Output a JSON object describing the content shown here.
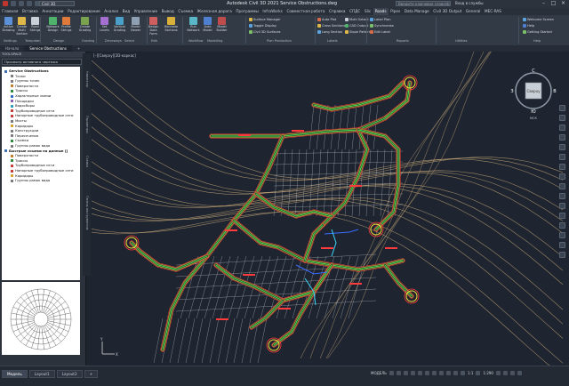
{
  "app_title": "Autodesk Civil 3D 2021    Service Obstructions.dwg",
  "workspace": "Civil 3D",
  "search_placeholder": "Введите ключевое слово/фразу",
  "user": "Вход в службы",
  "ribbon_tabs": [
    "Главная",
    "Вставка",
    "Аннотации",
    "Редактирование",
    "Анализ",
    "Вид",
    "Управление",
    "Вывод",
    "Съемка",
    "Железная дорога",
    "Программы",
    "InfraWorks",
    "Совместная работа",
    "Справка",
    "СПДС",
    "Slic",
    "Roads",
    "Pipes",
    "Data Manage",
    "Civil 3D Output",
    "General",
    "MEC-RAS"
  ],
  "active_ribbon_tab": "Roads",
  "ribbon": {
    "buttons": [
      {
        "label": "Active Drawing",
        "color": "#5b8fd6"
      },
      {
        "label": "Create Multi Section",
        "color": "#e0b84a"
      },
      {
        "label": "Road Strings",
        "color": "#c9d0d8"
      },
      {
        "label": "Network Design",
        "color": "#4fb36b"
      },
      {
        "label": "Profile Strings",
        "color": "#e07a3a"
      },
      {
        "label": "Create Grading",
        "color": "#7aa34f"
      },
      {
        "label": "Set Levels",
        "color": "#a56fd1"
      },
      {
        "label": "Vertical Grading",
        "color": "#4aa0c9"
      },
      {
        "label": "Model Viewer",
        "color": "#8fa0b3"
      },
      {
        "label": "Design Data Form",
        "color": "#cf5f5f"
      },
      {
        "label": "Recreate Sections",
        "color": "#d9b03a"
      },
      {
        "label": "Run Network",
        "color": "#5ab7c8"
      },
      {
        "label": "Auto Model",
        "color": "#4e7fd0"
      },
      {
        "label": "Model Builder",
        "color": "#bf4c4c"
      }
    ],
    "small_tools": [
      {
        "label": "Surface Manager",
        "color": "#e0b84a"
      },
      {
        "label": "Toggle Display",
        "color": "#5aa3e0"
      },
      {
        "label": "Civil 3D Surfaces",
        "color": "#7bbf6a"
      },
      {
        "label": "Auto Plot",
        "color": "#d46a4a"
      },
      {
        "label": "Cross Sections",
        "color": "#e0b84a"
      },
      {
        "label": "Long Section",
        "color": "#5aa3e0"
      },
      {
        "label": "Multi Setout",
        "color": "#c9d0d8"
      },
      {
        "label": "CAD Output",
        "color": "#4fb36b"
      },
      {
        "label": "Slope Pattern",
        "color": "#e0b84a"
      },
      {
        "label": "Label Plan",
        "color": "#5aa3e0"
      },
      {
        "label": "Synchronise",
        "color": "#7bbf6a"
      },
      {
        "label": "Edit Label",
        "color": "#d46a4a"
      },
      {
        "label": "Welcome Screen",
        "color": "#5aa3e0"
      },
      {
        "label": "Help",
        "color": "#4e7fd0"
      },
      {
        "label": "Getting Started",
        "color": "#7bbf6a"
      }
    ],
    "panels": [
      "Settings",
      "Templates",
      "Design",
      "Grading",
      "Driveways",
      "Select",
      "Edit",
      "Workflow",
      "Modelling",
      "Plan Production",
      "Labels",
      "Reports",
      "Utilities",
      "Help"
    ]
  },
  "doc_tabs": [
    "Начало",
    "Service Obstructions"
  ],
  "toolspace": {
    "title": "TOOLSPACE",
    "view": "Просмотр активного чертежа",
    "tree": [
      {
        "label": "Service Obstructions",
        "level": 0,
        "color": "#3a6fb8"
      },
      {
        "label": "Точки",
        "level": 1,
        "color": "#7a7a7a"
      },
      {
        "label": "Группы точек",
        "level": 1,
        "color": "#7a7a7a"
      },
      {
        "label": "Поверхности",
        "level": 1,
        "color": "#c27a2a"
      },
      {
        "label": "Трассы",
        "level": 1,
        "color": "#2a8a3a"
      },
      {
        "label": "Характерные линии",
        "level": 1,
        "color": "#2a6ac2"
      },
      {
        "label": "Площадки",
        "level": 1,
        "color": "#8a5ab2"
      },
      {
        "label": "Водосборы",
        "level": 1,
        "color": "#2a9ab2"
      },
      {
        "label": "Трубопроводные сети",
        "level": 1,
        "color": "#c23a3a"
      },
      {
        "label": "Напорные трубопроводные сети",
        "level": 1,
        "color": "#c23a3a"
      },
      {
        "label": "Мосты",
        "level": 1,
        "color": "#7a7a7a"
      },
      {
        "label": "Коридоры",
        "level": 1,
        "color": "#d2a22a"
      },
      {
        "label": "Конструкции",
        "level": 1,
        "color": "#7a7a7a"
      },
      {
        "label": "Пересечения",
        "level": 1,
        "color": "#7a7a7a"
      },
      {
        "label": "Съемка",
        "level": 1,
        "color": "#2a8a3a"
      },
      {
        "label": "Группы рамок вида",
        "level": 1,
        "color": "#7a7a7a"
      },
      {
        "label": "Быстрые ссылки на данные []",
        "level": 0,
        "color": "#3a6fb8"
      },
      {
        "label": "Поверхности",
        "level": 1,
        "color": "#c27a2a"
      },
      {
        "label": "Трассы",
        "level": 1,
        "color": "#2a8a3a"
      },
      {
        "label": "Трубопроводные сети",
        "level": 1,
        "color": "#c23a3a"
      },
      {
        "label": "Напорные трубопроводные сети",
        "level": 1,
        "color": "#c23a3a"
      },
      {
        "label": "Коридоры",
        "level": 1,
        "color": "#d2a22a"
      },
      {
        "label": "Группы рамок вида",
        "level": 1,
        "color": "#7a7a7a"
      }
    ],
    "side_tabs": [
      "Навигатор",
      "Параметры",
      "Съемка",
      "Панель инструментов"
    ]
  },
  "viewport": {
    "label": "[–][Сверху][2D-каркас]",
    "navcube": {
      "top": "Сверху",
      "n": "С",
      "s": "Ю",
      "w": "З",
      "e": "В",
      "wcs": "МСК"
    }
  },
  "layout_tabs": [
    "Модель",
    "Layout1",
    "Layout2",
    "+"
  ],
  "status": {
    "mode": "МОДЕЛЬ",
    "scale": "1:1",
    "zoom": "1:290"
  },
  "colors": {
    "road_green": "#46d14a",
    "road_yellow": "#f2df3a",
    "road_red": "#ff3b3b",
    "contour": "#c9a97a",
    "parcel": "#cfd4da",
    "pipe_blue": "#3a6cff",
    "pipe_cyan": "#3ad8ff"
  }
}
